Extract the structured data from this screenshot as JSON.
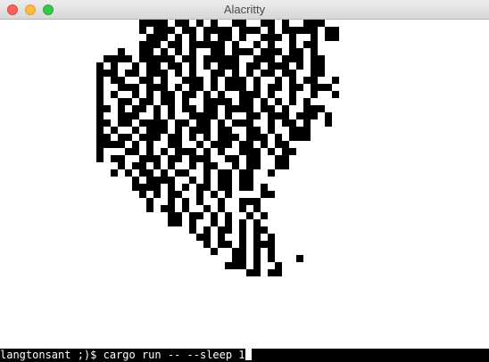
{
  "window": {
    "title": "Alacritty"
  },
  "terminal": {
    "prompt": "langtonsant ;)$ ",
    "command": "cargo run -- --sleep 1",
    "background_color": "#ffffff",
    "cell_color": "#000000",
    "rows": [
      "..................####.##.#.#..##..##.#..###..........",
      "..................#.###.##.####.###.#.#####.##........",
      "...................###.#.#.#.##.#..###.#..#.##........",
      "..................###.##.#####.#..#.#..#.##...........",
      "...............#..##.#.#.#..##.###.###.##.#...........",
      ".............####.#####.##.#####..###.###.##..........",
      "............#.#..#.##.##.#.#.###.##.###.#.##..........",
      "............###.##.###.#.#..##.#.#.##.##..##..........",
      "............#.##..##.#..###.#.###.#..#.#.##..#........",
      "............#..###.###.#.##.#.###.#.##.##.###.........",
      "............#.#..#.#.##.##.#.#..###.#..#..#..#........",
      "............#..##.##.##.#..####.##.#.#.#.#............",
      "............##.#.##.#.#.##.##.####.##.#..###..........",
      "............#..###..#.#..####.#..##.###.###.#.........",
      "............##.##.####.##.##.#.###..#.##.#..#.........",
      "............#.#..#.###.#.###.##..##.#..###............",
      "............##.##.###.##.#.#.###.###.#.###............",
      "............####.#.#..##..#.###.##.#.##...............",
      "............#...##.#.#.###.#.#..###.#.##..............",
      "............#.##..###.##.###..##.##..##...............",
      "...............#.##.#.#..#.##..#.##..##...............",
      "..............#.#.##.#.##..#.##.##..#.................",
      ".................#.####..#.#.##.##....................",
      ".................####.#.#.##.##.##.#..................",
      "..................#.#.##..#.#.#....##.................",
      "...................#..#.#.#..#..###...................",
      "...................#.##.#..#.#..#.#...................",
      "......................##.##.#.#..#.#..................",
      "......................##.#..#.#.#.#...................",
      ".........................#.#.##.#.##..................",
      "..........................##.#..#.#.#.................",
      "...........................#.##.#.###.................",
      "............................#..##.#.#.................",
      "...............................##.#.#...#............",
      "..............................###.#..#................",
      ".................................##.##................"
    ]
  }
}
